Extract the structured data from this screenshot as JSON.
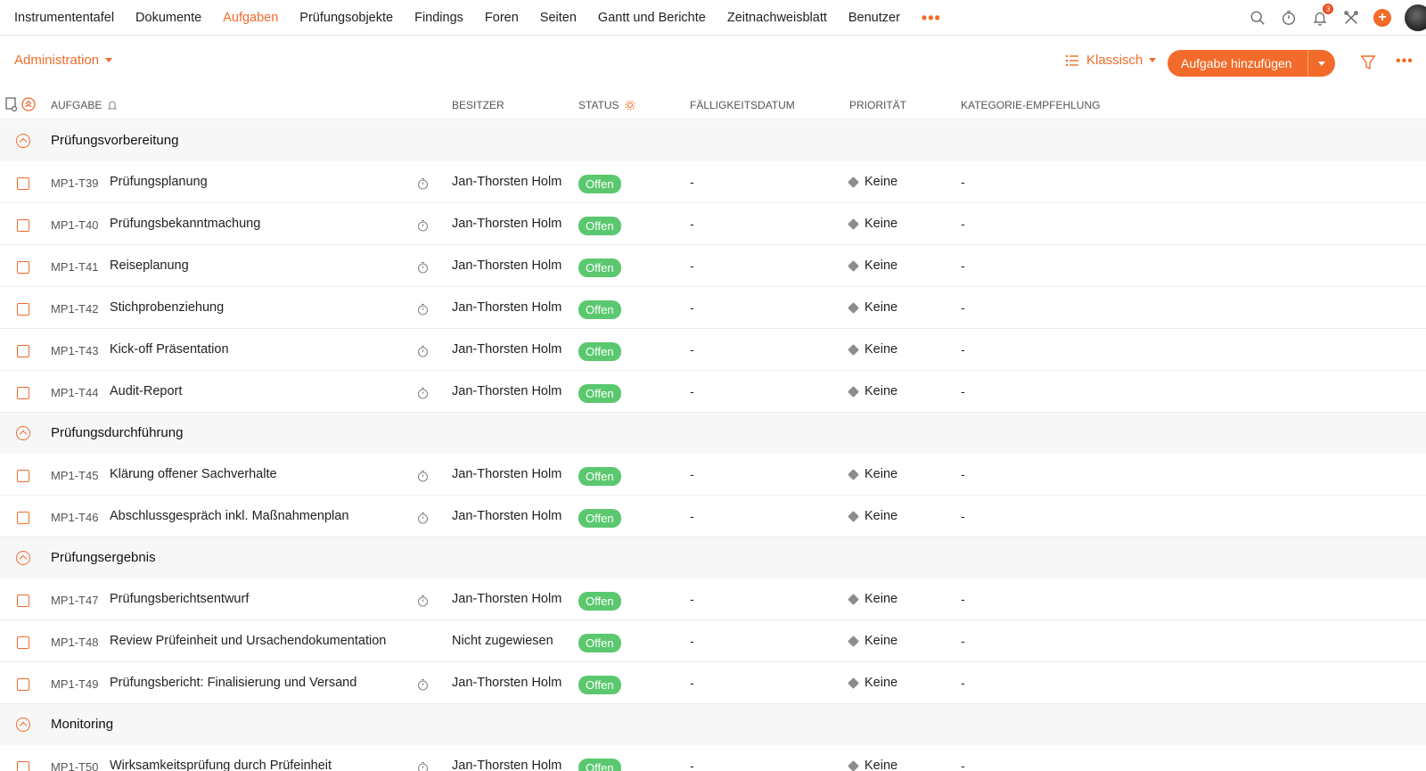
{
  "nav": {
    "items": [
      "Instrumententafel",
      "Dokumente",
      "Aufgaben",
      "Prüfungsobjekte",
      "Findings",
      "Foren",
      "Seiten",
      "Gantt und Berichte",
      "Zeitnachweisblatt",
      "Benutzer"
    ],
    "active_index": 2,
    "more": "•••",
    "notification_count": "3",
    "plus": "+"
  },
  "toolbar": {
    "project_dropdown": "Administration",
    "view_label": "Klassisch",
    "add_button": "Aufgabe hinzufügen",
    "more": "•••"
  },
  "columns": {
    "task": "AUFGABE",
    "owner": "BESITZER",
    "status": "STATUS",
    "due": "FÄLLIGKEITSDATUM",
    "priority": "PRIORITÄT",
    "category": "KATEGORIE-EMPFEHLUNG"
  },
  "groups": [
    {
      "title": "Prüfungsvorbereitung",
      "tasks": [
        {
          "id": "MP1-T39",
          "name": "Prüfungsplanung",
          "owner": "Jan-Thorsten Holm",
          "status": "Offen",
          "due": "-",
          "priority": "Keine",
          "category": "-",
          "timer": true
        },
        {
          "id": "MP1-T40",
          "name": "Prüfungsbekanntmachung",
          "owner": "Jan-Thorsten Holm",
          "status": "Offen",
          "due": "-",
          "priority": "Keine",
          "category": "-",
          "timer": true
        },
        {
          "id": "MP1-T41",
          "name": "Reiseplanung",
          "owner": "Jan-Thorsten Holm",
          "status": "Offen",
          "due": "-",
          "priority": "Keine",
          "category": "-",
          "timer": true
        },
        {
          "id": "MP1-T42",
          "name": "Stichprobenziehung",
          "owner": "Jan-Thorsten Holm",
          "status": "Offen",
          "due": "-",
          "priority": "Keine",
          "category": "-",
          "timer": true
        },
        {
          "id": "MP1-T43",
          "name": "Kick-off Präsentation",
          "owner": "Jan-Thorsten Holm",
          "status": "Offen",
          "due": "-",
          "priority": "Keine",
          "category": "-",
          "timer": true
        },
        {
          "id": "MP1-T44",
          "name": "Audit-Report",
          "owner": "Jan-Thorsten Holm",
          "status": "Offen",
          "due": "-",
          "priority": "Keine",
          "category": "-",
          "timer": true
        }
      ]
    },
    {
      "title": "Prüfungsdurchführung",
      "tasks": [
        {
          "id": "MP1-T45",
          "name": "Klärung offener Sachverhalte",
          "owner": "Jan-Thorsten Holm",
          "status": "Offen",
          "due": "-",
          "priority": "Keine",
          "category": "-",
          "timer": true
        },
        {
          "id": "MP1-T46",
          "name": "Abschlussgespräch inkl. Maßnahmenplan",
          "owner": "Jan-Thorsten Holm",
          "status": "Offen",
          "due": "-",
          "priority": "Keine",
          "category": "-",
          "timer": true
        }
      ]
    },
    {
      "title": "Prüfungsergebnis",
      "tasks": [
        {
          "id": "MP1-T47",
          "name": "Prüfungsberichtsentwurf",
          "owner": "Jan-Thorsten Holm",
          "status": "Offen",
          "due": "-",
          "priority": "Keine",
          "category": "-",
          "timer": true
        },
        {
          "id": "MP1-T48",
          "name": "Review Prüfeinheit und Ursachendokumentation",
          "owner": "Nicht zugewiesen",
          "status": "Offen",
          "due": "-",
          "priority": "Keine",
          "category": "-",
          "timer": false
        },
        {
          "id": "MP1-T49",
          "name": "Prüfungsbericht: Finalisierung und Versand",
          "owner": "Jan-Thorsten Holm",
          "status": "Offen",
          "due": "-",
          "priority": "Keine",
          "category": "-",
          "timer": true
        }
      ]
    },
    {
      "title": "Monitoring",
      "tasks": [
        {
          "id": "MP1-T50",
          "name": "Wirksamkeitsprüfung durch Prüfeinheit",
          "owner": "Jan-Thorsten Holm",
          "status": "Offen",
          "due": "-",
          "priority": "Keine",
          "category": "-",
          "timer": true
        }
      ]
    }
  ],
  "colors": {
    "accent": "#f26b2a",
    "status_open": "#5bc86f",
    "group_bg": "#f7f7f8"
  }
}
